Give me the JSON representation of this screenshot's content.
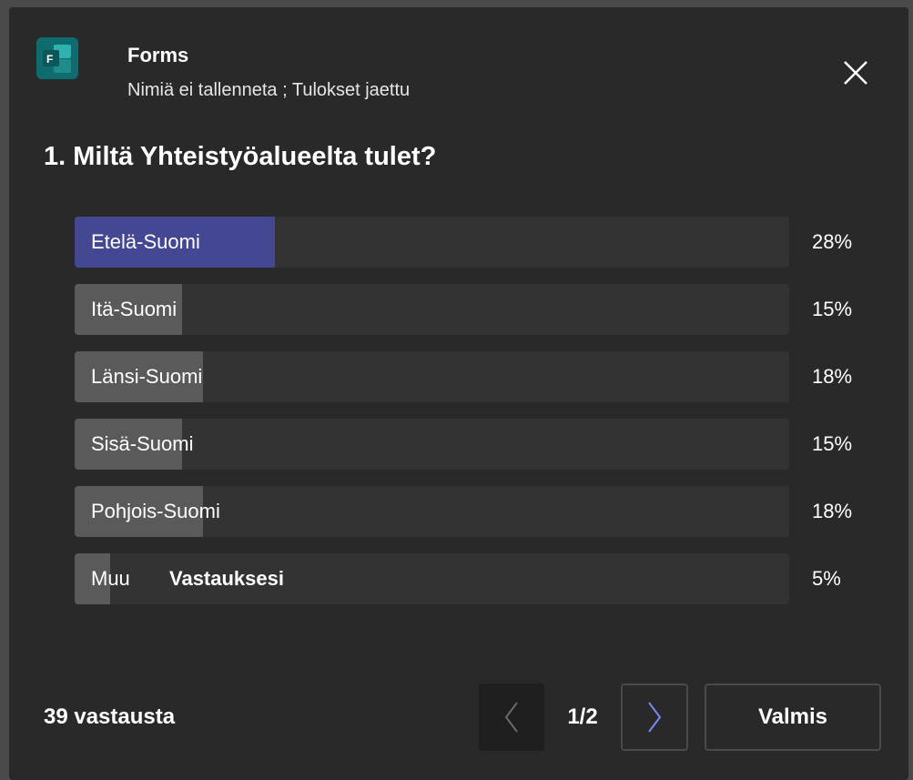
{
  "header": {
    "app_name": "Forms",
    "subtitle": "Nimiä ei tallenneta ; Tulokset jaettu",
    "icon": "forms-app-icon",
    "close_icon": "close-icon"
  },
  "question": {
    "title": "1. Miltä Yhteistyöalueelta tulet?"
  },
  "options": [
    {
      "label": "Etelä-Suomi",
      "percent_label": "28%",
      "fraction": 0.28,
      "selected": true
    },
    {
      "label": "Itä-Suomi",
      "percent_label": "15%",
      "fraction": 0.15,
      "selected": false
    },
    {
      "label": "Länsi-Suomi",
      "percent_label": "18%",
      "fraction": 0.18,
      "selected": false
    },
    {
      "label": "Sisä-Suomi",
      "percent_label": "15%",
      "fraction": 0.15,
      "selected": false
    },
    {
      "label": "Pohjois-Suomi",
      "percent_label": "18%",
      "fraction": 0.18,
      "selected": false
    },
    {
      "label": "Muu",
      "percent_label": "5%",
      "fraction": 0.05,
      "selected": false,
      "your_answer_label": "Vastauksesi"
    }
  ],
  "footer": {
    "responses": "39 vastausta",
    "page": "1/2",
    "prev_icon": "chevron-left-icon",
    "next_icon": "chevron-right-icon",
    "done_label": "Valmis"
  },
  "colors": {
    "background": "#292929",
    "bar_track": "#333333",
    "bar_fill": "#5a5a5a",
    "bar_selected": "#444791",
    "next_chevron": "#7f85f5"
  }
}
